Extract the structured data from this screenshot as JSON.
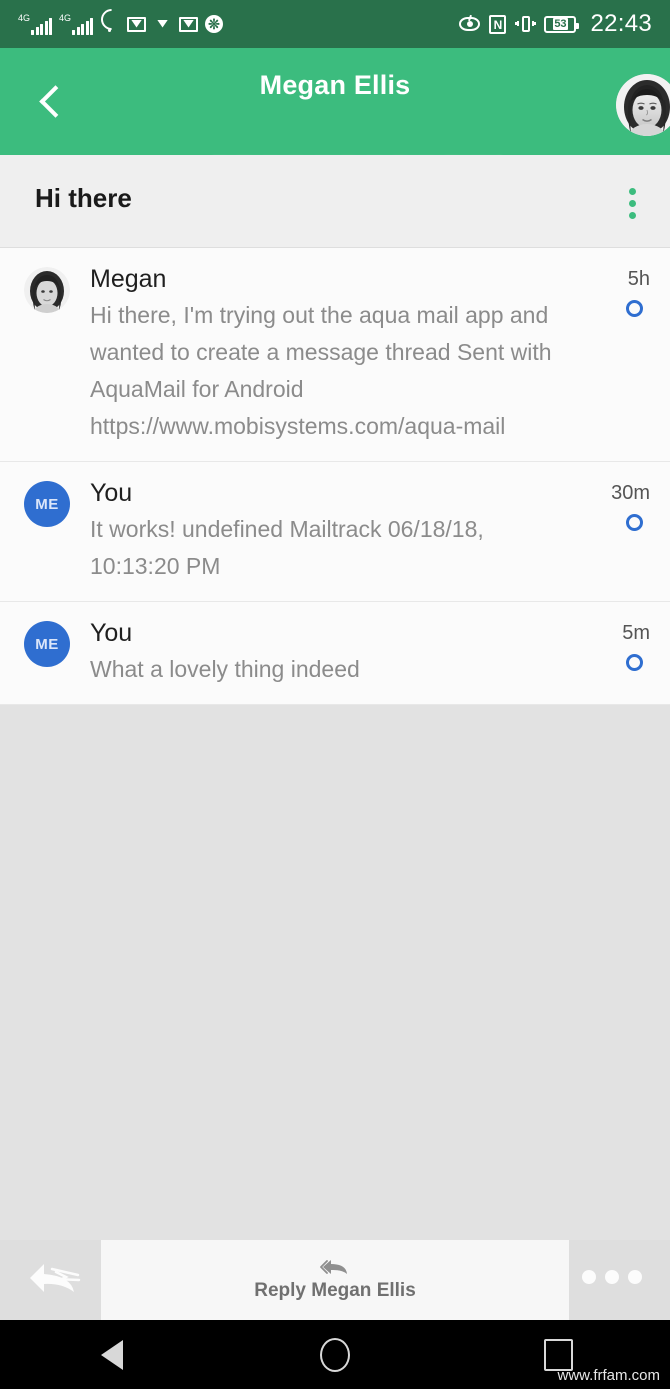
{
  "status_bar": {
    "network_label_1": "4G",
    "network_label_2": "4G",
    "icons": [
      "signal-4g-1",
      "signal-4g-2",
      "wifi",
      "gmail-1",
      "mail-open",
      "gmail-2",
      "asterisk-badge",
      "eye-comfort",
      "nfc",
      "vibrate",
      "battery"
    ],
    "nfc_label": "N",
    "battery_level": "53",
    "time": "22:43",
    "background_color": "#29714b",
    "foreground_color": "#ffffff"
  },
  "app_bar": {
    "title": "Megan Ellis",
    "subtitle_redacted": "",
    "back_label": "Back",
    "avatar_label": "Megan Ellis avatar",
    "background_color": "#3cbc7e",
    "title_color": "#ffffff"
  },
  "subject_bar": {
    "subject": "Hi there",
    "menu_label": "More options",
    "background_color": "#efefef",
    "menu_dot_color": "#3cbc7e"
  },
  "messages": [
    {
      "sender": "Megan",
      "avatar_type": "photo",
      "initials": "",
      "snippet": "Hi there, I'm trying out the aqua mail app and wanted to create a message thread Sent with AquaMail for Android https://www.mobisystems.com/aqua-mail",
      "time": "5h",
      "unread": true
    },
    {
      "sender": "You",
      "avatar_type": "initials",
      "initials": "ME",
      "snippet": "It works! undefined Mailtrack 06/18/18, 10:13:20 PM",
      "time": "30m",
      "unread": true
    },
    {
      "sender": "You",
      "avatar_type": "initials",
      "initials": "ME",
      "snippet": "What a lovely thing indeed",
      "time": "5m",
      "unread": true
    }
  ],
  "bottom_bar": {
    "reply_all_label": "Reply all",
    "reply_label": "Reply Megan Ellis",
    "more_label": "More actions",
    "background_color": "#dedede",
    "card_color": "#f7f7f7"
  },
  "nav_bar": {
    "back_label": "Back",
    "home_label": "Home",
    "recents_label": "Recent apps",
    "background_color": "#000000"
  },
  "watermark": {
    "text": "www.frfam.com"
  },
  "colors": {
    "accent_green": "#3cbc7e",
    "status_green": "#29714b",
    "unread_blue": "#2f6ed0",
    "list_bg": "#fbfbfb",
    "empty_bg": "#e2e2e2"
  }
}
